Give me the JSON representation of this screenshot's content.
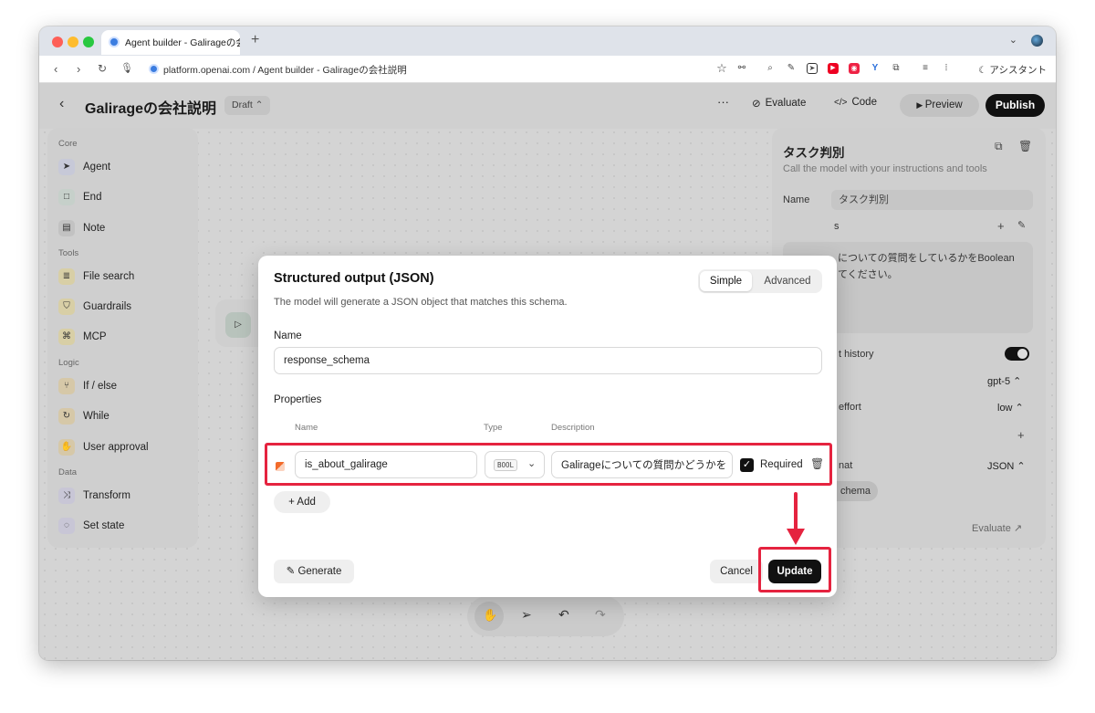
{
  "browser": {
    "tab_title": "Agent builder - Galirageの会",
    "new_tab": "+",
    "url": "platform.openai.com / Agent builder - Galirageの会社説明",
    "assistant_label": "アシスタント"
  },
  "header": {
    "back": "‹",
    "title": "Galirageの会社説明",
    "draft": "Draft ⌃",
    "more": "···",
    "evaluate": "Evaluate",
    "code": "Code",
    "preview": "Preview",
    "publish": "Publish"
  },
  "sidebar": {
    "sections": [
      "Core",
      "Tools",
      "Logic",
      "Data"
    ],
    "items": [
      {
        "label": "Agent",
        "icon": "pointer-icon"
      },
      {
        "label": "End",
        "icon": "stop-icon"
      },
      {
        "label": "Note",
        "icon": "note-icon"
      },
      {
        "label": "File search",
        "icon": "database-icon"
      },
      {
        "label": "Guardrails",
        "icon": "shield-icon"
      },
      {
        "label": "MCP",
        "icon": "command-icon"
      },
      {
        "label": "If / else",
        "icon": "branch-icon"
      },
      {
        "label": "While",
        "icon": "loop-icon"
      },
      {
        "label": "User approval",
        "icon": "approval-icon"
      },
      {
        "label": "Transform",
        "icon": "shuffle-icon"
      },
      {
        "label": "Set state",
        "icon": "state-icon"
      }
    ]
  },
  "right_panel": {
    "title": "タスク判別",
    "subtitle": "Call the model with your instructions and tools",
    "name_label": "Name",
    "name_value": "タスク判別",
    "instructions_tail": "s",
    "instructions_text_1": "についての質問をしているかをBoolean",
    "instructions_text_2": "てください。",
    "history_label": "t history",
    "model_value": "gpt-5 ⌃",
    "effort_label": "effort",
    "effort_value": "low ⌃",
    "plus": "+",
    "format_label": "nat",
    "format_value": "JSON ⌃",
    "schema_chip": "chema",
    "evaluate_link": "Evaluate"
  },
  "modal": {
    "title": "Structured output (JSON)",
    "description": "The model will generate a JSON object that matches this schema.",
    "mode_simple": "Simple",
    "mode_advanced": "Advanced",
    "name_label": "Name",
    "name_value": "response_schema",
    "properties_label": "Properties",
    "col_name": "Name",
    "col_type": "Type",
    "col_description": "Description",
    "property": {
      "name": "is_about_galirage",
      "type": "BOOL",
      "description": "Galirageについての質問かどうかを",
      "required_label": "Required",
      "required": true
    },
    "add_label": "Add",
    "generate_label": "Generate",
    "cancel_label": "Cancel",
    "update_label": "Update"
  },
  "colors": {
    "highlight": "#e5233f",
    "primary_button": "#111111"
  }
}
